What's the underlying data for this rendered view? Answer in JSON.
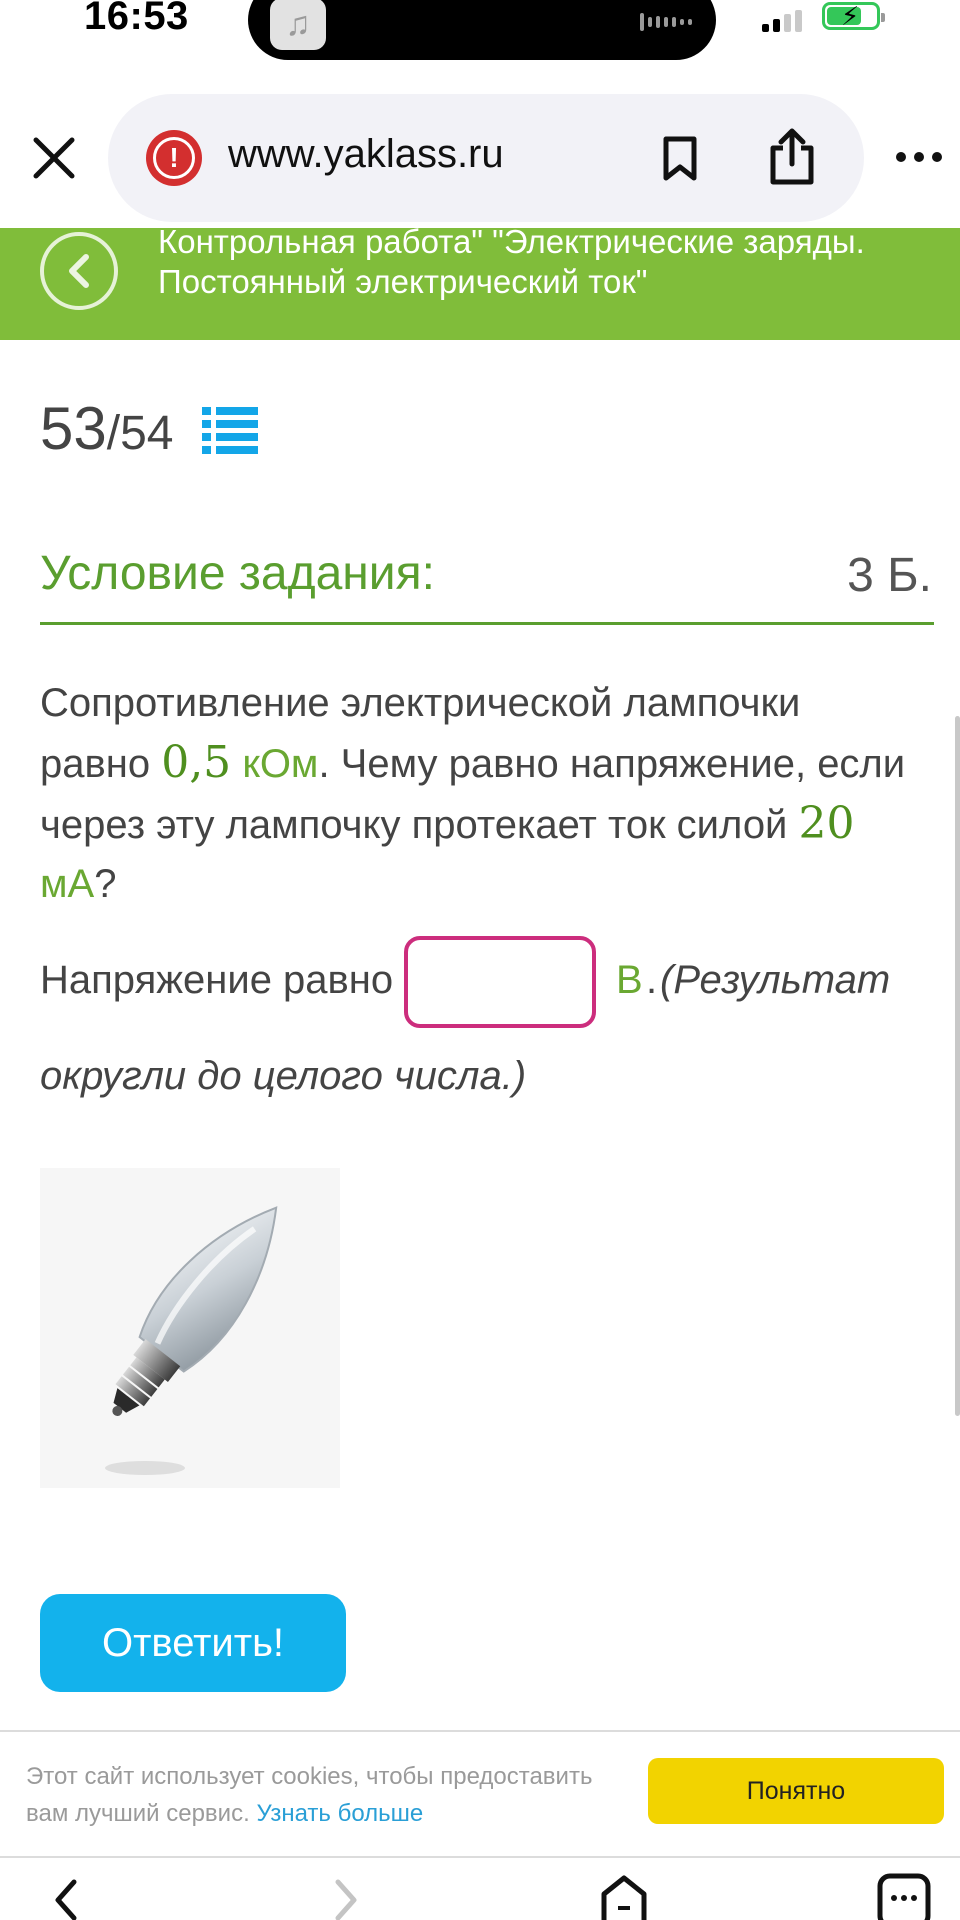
{
  "status_bar": {
    "time": "16:53",
    "battery_level": 0.7,
    "battery_charging": true,
    "signal_bars_active": 2,
    "signal_bars_total": 4
  },
  "browser": {
    "url": "www.yaklass.ru",
    "security_icon": "warning-icon",
    "icons": [
      "close-icon",
      "bookmark-icon",
      "share-icon",
      "more-icon"
    ]
  },
  "header": {
    "title": "Контрольная работа\" \"Электрические заряды. Постоянный электрический ток\"",
    "back_icon": "chevron-left-icon"
  },
  "progress": {
    "current": "53",
    "total": "/54"
  },
  "task": {
    "heading": "Условие задания:",
    "points": "3 Б.",
    "text_part1": "Сопротивление электрической лампочки равно ",
    "resistance_value": "0,5",
    "resistance_unit": "кОм",
    "text_part2": ". Чему равно напряжение, если через эту лампочку протекает ток силой ",
    "current_value": "20",
    "current_unit": "мА",
    "text_part3": "?"
  },
  "answer": {
    "label": "Напряжение равно",
    "value": "",
    "unit": "В",
    "dot": ".",
    "note_part1": "(Результат",
    "note_part2": "округли до целого числа.)"
  },
  "submit_label": "Ответить!",
  "cookie": {
    "text": "Этот сайт использует cookies, чтобы предоставить вам лучший сервис. ",
    "link": "Узнать больше",
    "button": "Понятно"
  },
  "colors": {
    "header_green": "#80bd3a",
    "accent_green": "#5a9e2f",
    "button_blue": "#13b2ec",
    "input_border": "#cc2d7d",
    "cookie_button": "#f2d300"
  }
}
